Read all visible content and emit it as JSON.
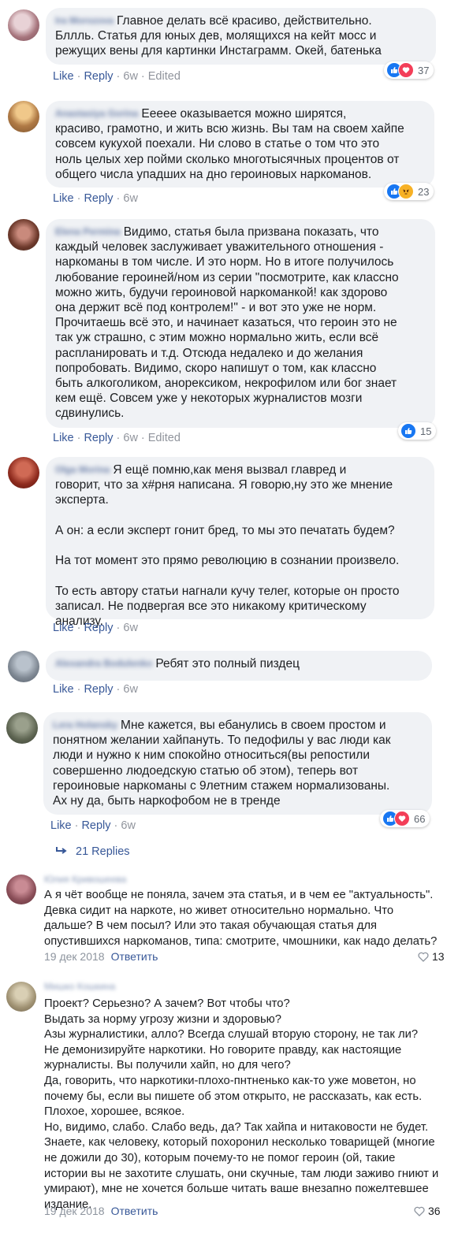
{
  "labels": {
    "like": "Like",
    "reply": "Reply",
    "dot": "·",
    "edited": "Edited",
    "answer": "Ответить",
    "replies": "21 Replies"
  },
  "comments": [
    {
      "author": "Ira Morozova",
      "time": "6w",
      "edited": true,
      "reactions": "37",
      "text": "Главное делать всё красиво, действительно.\nБллль. Статья для юных дев, молящихся на кейт мосс и\nрежущих вены для картинки Инстаграмм. Окей, батенька"
    },
    {
      "author": "Anastasiya Gorina",
      "time": "6w",
      "edited": false,
      "reactions": "23",
      "text": "Ееееe оказывается можно ширятся,\nкрасиво, грамотно, и жить всю жизнь. Вы там на своем хайпе\nсовсем кукухой поехали. Ни слово в статье о том что это\nноль целых хер пойми сколько многотысячных процентов от\nобщего числа упадших на дно героиновых наркоманов."
    },
    {
      "author": "Elena Permina",
      "time": "6w",
      "edited": true,
      "reactions": "15",
      "text": "Видимо, статья была призвана показать, что\nкаждый человек заслуживает уважительного отношения -\nнаркоманы в том числе. И это норм. Но в итоге получилось\nлюбование героиней/ном из серии \"посмотрите, как классно\nможно жить, будучи героиновой наркоманкой! как здорово\nона держит всё под контролем!\" - и вот это уже не норм.\nПрочитаешь всё это, и начинает казаться, что героин это не\nтак уж страшно, с этим можно нормально жить, если всё\nраспланировать и т.д. Отсюда недалеко и до желания\nпопробовать. Видимо, скоро напишут о том, как классно\nбыть алкоголиком, анорексиком, некрофилом или бог знает\nкем ещё. Совсем уже у некоторых журналистов мозги\nсдвинулись."
    },
    {
      "author": "Olga Morina",
      "time": "6w",
      "edited": false,
      "reactions": "",
      "text": "Я ещё помню,как меня вызвал главред и\nговорит, что за х#рня написана. Я говорю,ну это же мнение\nэксперта.\n\nА он: а если эксперт гонит бред, то мы это печатать будем?\n\nНа тот момент это прямо революцию в сознании произвело.\n\nТо есть автору статьи нагнали кучу телег, которые он просто\nзаписал. Не подвергая все это никакому критическому\nанализу."
    },
    {
      "author": "Alexandra Bodulenko",
      "time": "6w",
      "edited": false,
      "reactions": "",
      "text": "Ребят это полный пиздец"
    },
    {
      "author": "Lera Holansky",
      "time": "6w",
      "edited": false,
      "reactions": "66",
      "text": "Мне кажется, вы ебанулись в своем простом и\nпонятном желании хайпануть. То педофилы у вас люди как\nлюди и нужно к ним спокойно относиться(вы репостили\nсовершенно людоедскую статью об этом), теперь вот\nгероиновые наркоманы с 9летним стажем нормализованы.\nАх ну да, быть наркофобом не в тренде"
    }
  ],
  "posts": [
    {
      "author": "Юлия Кривошеева",
      "date": "19 дек 2018",
      "likes": "13",
      "text": "А я чёт вообще не поняла, зачем эта статья, и в чем ее \"актуальность\".\nДевка сидит на наркоте, но живет относительно нормально. Что\nдальше? В чем посыл? Или это такая обучающая статья для\nопустившихся наркоманов, типа: смотрите, чмошники, как надо делать?"
    },
    {
      "author": "Мишко Кошкина",
      "date": "19 дек 2018",
      "likes": "36",
      "text": "Проект? Серьезно? А зачем? Вот чтобы что?\nВыдать за норму угрозу жизни и здоровью?\nАзы журналистики, алло? Всегда слушай вторую сторону, не так ли?\nНе демонизируйте наркотики. Но говорите правду, как настоящие\nжурналисты. Вы получили хайп, но для чего?\nДа, говорить, что наркотики-плохо-пнтненько как-то уже моветон, но\nпочему бы, если вы пишете об этом открыто, не рассказать, как есть.\nПлохое, хорошее, всякое.\nНо, видимо, слабо. Слабо ведь, да? Так хайпа и нитаковости не будет.\nЗнаете, как человеку, который похоронил несколько товарищей (многие\nне дожили до 30), которым почему-то не помог героин (ой, такие\nистории вы не захотите слушать, они скучные, там люди заживо гниют и\nумирают), мне не хочется больше читать ваше внезапно пожелтевшее\nиздание."
    }
  ],
  "colors": {
    "bubble": "#f0f2f5",
    "link": "#385898",
    "like": "#1877f2",
    "love": "#f33e58",
    "angry": "#f7b125"
  }
}
